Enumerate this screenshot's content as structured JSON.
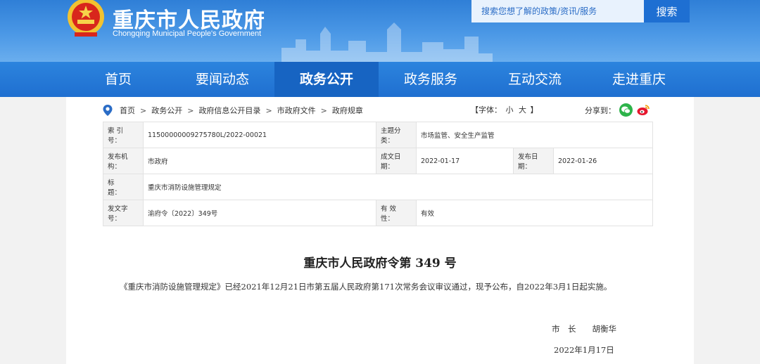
{
  "header": {
    "title": "重庆市人民政府",
    "subtitle": "Chongqing Municipal People's Government",
    "search_placeholder": "搜索您想了解的政策/资讯/服务",
    "search_button": "搜索"
  },
  "nav": {
    "items": [
      {
        "label": "首页"
      },
      {
        "label": "要闻动态"
      },
      {
        "label": "政务公开"
      },
      {
        "label": "政务服务"
      },
      {
        "label": "互动交流"
      },
      {
        "label": "走进重庆"
      }
    ],
    "active": "政务公开"
  },
  "breadcrumb": {
    "items": [
      "首页",
      "政务公开",
      "政府信息公开目录",
      "市政府文件",
      "政府规章"
    ],
    "separator": ">"
  },
  "font_size": {
    "prefix": "【字体：",
    "small": "小",
    "large": "大",
    "suffix": "】"
  },
  "share": {
    "label": "分享到：",
    "icons": [
      "wechat-icon",
      "weibo-icon"
    ]
  },
  "meta": {
    "index_label": "索 引 号：",
    "index_value": "11500000009275780L/2022-00021",
    "category_label": "主题分类：",
    "category_value": "市场监管、安全生产监管",
    "issuer_label": "发布机构：",
    "issuer_value": "市政府",
    "written_label": "成文日期：",
    "written_value": "2022-01-17",
    "published_label": "发布日期：",
    "published_value": "2022-01-26",
    "title_label": "标　　题：",
    "title_value": "重庆市消防设施管理规定",
    "doc_no_label": "发文字号：",
    "doc_no_value": "渝府令〔2022〕349号",
    "validity_label": "有 效 性：",
    "validity_value": "有效"
  },
  "document": {
    "title": "重庆市人民政府令第 349 号",
    "body": "《重庆市消防设施管理规定》已经2021年12月21日市第五届人民政府第171次常务会议审议通过，现予公布，自2022年3月1日起实施。",
    "signature": "市　长　　胡衡华",
    "date": "2022年1月17日"
  },
  "colors": {
    "header_blue": "#2f7fd7",
    "nav_blue": "#1f6fd0",
    "nav_active": "#1764c2",
    "search_button": "#1e6fd2"
  }
}
